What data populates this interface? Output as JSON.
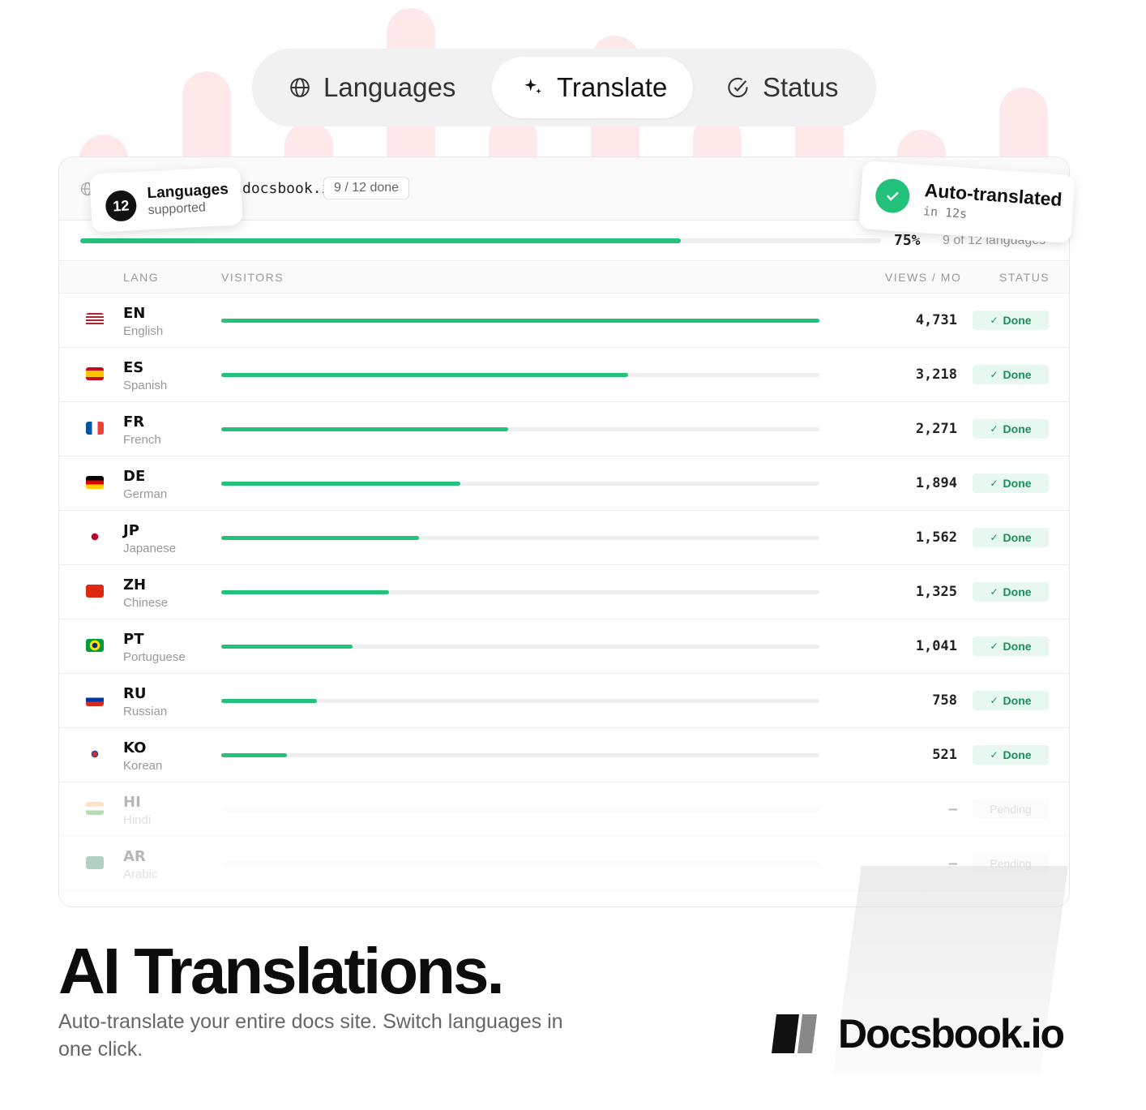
{
  "tabs": [
    {
      "label": "Languages",
      "icon": "globe-icon"
    },
    {
      "label": "Translate",
      "icon": "sparkle-icon",
      "active": true
    },
    {
      "label": "Status",
      "icon": "check-circle-icon"
    }
  ],
  "card": {
    "domain": "docsbook.io",
    "done_chip": "9 / 12 done",
    "progress": {
      "percent_label": "75%",
      "fraction": 0.75,
      "of_label": "9 of 12 languages"
    },
    "headers": {
      "lang": "LANG",
      "visitors": "VISITORS",
      "views": "VIEWS / MO",
      "status": "STATUS"
    },
    "rows": [
      {
        "code": "EN",
        "name": "English",
        "views": "4,731",
        "status": "Done",
        "fill": 1.0,
        "flag": "us"
      },
      {
        "code": "ES",
        "name": "Spanish",
        "views": "3,218",
        "status": "Done",
        "fill": 0.68,
        "flag": "es"
      },
      {
        "code": "FR",
        "name": "French",
        "views": "2,271",
        "status": "Done",
        "fill": 0.48,
        "flag": "fr"
      },
      {
        "code": "DE",
        "name": "German",
        "views": "1,894",
        "status": "Done",
        "fill": 0.4,
        "flag": "de"
      },
      {
        "code": "JP",
        "name": "Japanese",
        "views": "1,562",
        "status": "Done",
        "fill": 0.33,
        "flag": "jp"
      },
      {
        "code": "ZH",
        "name": "Chinese",
        "views": "1,325",
        "status": "Done",
        "fill": 0.28,
        "flag": "cn"
      },
      {
        "code": "PT",
        "name": "Portuguese",
        "views": "1,041",
        "status": "Done",
        "fill": 0.22,
        "flag": "br"
      },
      {
        "code": "RU",
        "name": "Russian",
        "views": "758",
        "status": "Done",
        "fill": 0.16,
        "flag": "ru"
      },
      {
        "code": "KO",
        "name": "Korean",
        "views": "521",
        "status": "Done",
        "fill": 0.11,
        "flag": "kr"
      },
      {
        "code": "HI",
        "name": "Hindi",
        "views": "—",
        "status": "Pending",
        "fill": 0,
        "flag": "in"
      },
      {
        "code": "AR",
        "name": "Arabic",
        "views": "—",
        "status": "Pending",
        "fill": 0,
        "flag": "sa"
      }
    ]
  },
  "badges": {
    "languages": {
      "count": "12",
      "title": "Languages",
      "subtitle": "supported"
    },
    "auto": {
      "title": "Auto-translated",
      "subtitle": "in 12s"
    }
  },
  "footer": {
    "headline": "AI Translations.",
    "subline": "Auto-translate your entire docs site. Switch languages in one click.",
    "brand": "Docsbook.io"
  },
  "colors": {
    "accent": "#22c27b",
    "pink": "#fde8ea"
  }
}
